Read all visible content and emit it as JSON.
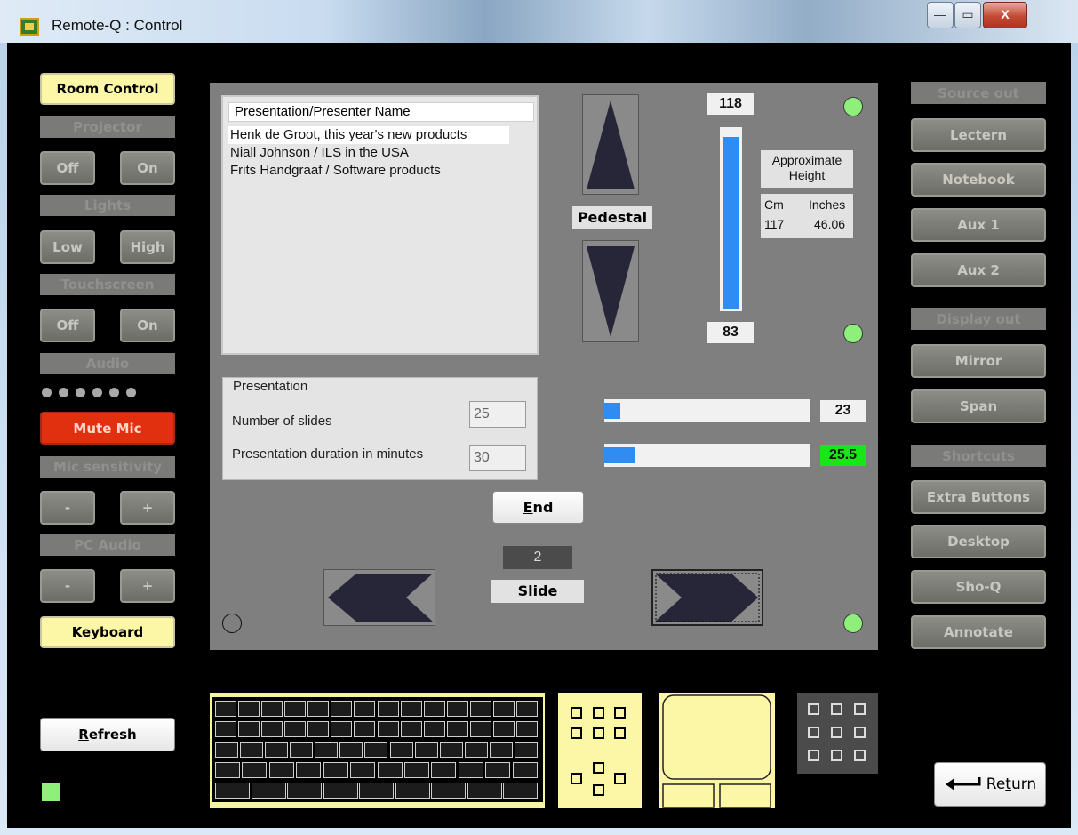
{
  "window": {
    "title": "Remote-Q : Control",
    "minimize_label": "—",
    "maximize_label": "▭",
    "close_label": "X"
  },
  "left": {
    "room_control": "Room Control",
    "projector_header": "Projector",
    "projector_off": "Off",
    "projector_on": "On",
    "lights_header": "Lights",
    "lights_low": "Low",
    "lights_high": "High",
    "touchscreen_header": "Touchscreen",
    "touch_off": "Off",
    "touch_on": "On",
    "audio_header": "Audio",
    "mute_mic": "Mute Mic",
    "mic_sens_header": "Mic sensitivity",
    "mic_minus": "-",
    "mic_plus": "+",
    "pc_audio_header": "PC Audio",
    "pc_minus": "-",
    "pc_plus": "+",
    "keyboard": "Keyboard",
    "refresh_pre": "",
    "refresh_u": "R",
    "refresh_post": "efresh"
  },
  "center": {
    "list_header": "Presentation/Presenter Name",
    "presentations": [
      "Henk de Groot, this year's new products",
      "Niall Johnson / ILS in the USA",
      "Frits Handgraaf / Software products"
    ],
    "group_title": "Presentation",
    "slides_label": "Number of slides",
    "slides_value": "25",
    "duration_label": "Presentation duration in minutes",
    "duration_value": "30",
    "pedestal_label": "Pedestal",
    "height_max": "118",
    "height_min": "83",
    "height_level": 0.97,
    "approx_label": "Approximate Height",
    "cm_label": "Cm",
    "inches_label": "Inches",
    "cm_value": "117",
    "inches_value": "46.06",
    "slider1_value": "23",
    "slider1_level": 0.08,
    "slider2_value": "25.5",
    "slider2_level": 0.15,
    "end_pre": "",
    "end_u": "E",
    "end_post": "nd",
    "slide_number": "2",
    "slide_label": "Slide"
  },
  "right": {
    "source_out_header": "Source out",
    "lectern": "Lectern",
    "notebook": "Notebook",
    "aux1": "Aux 1",
    "aux2": "Aux 2",
    "display_out_header": "Display out",
    "mirror": "Mirror",
    "span": "Span",
    "shortcuts_header": "Shortcuts",
    "extra_buttons": "Extra Buttons",
    "desktop": "Desktop",
    "sho_q": "Sho-Q",
    "annotate": "Annotate",
    "return_pre": "Re",
    "return_u": "t",
    "return_post": "urn"
  },
  "colors": {
    "status_green": "#8ef07a",
    "mute_red": "#e0300f",
    "slider_blue": "#2e8cf2",
    "highlight_green": "#19e619",
    "button_yellow": "#fbf7a6"
  }
}
